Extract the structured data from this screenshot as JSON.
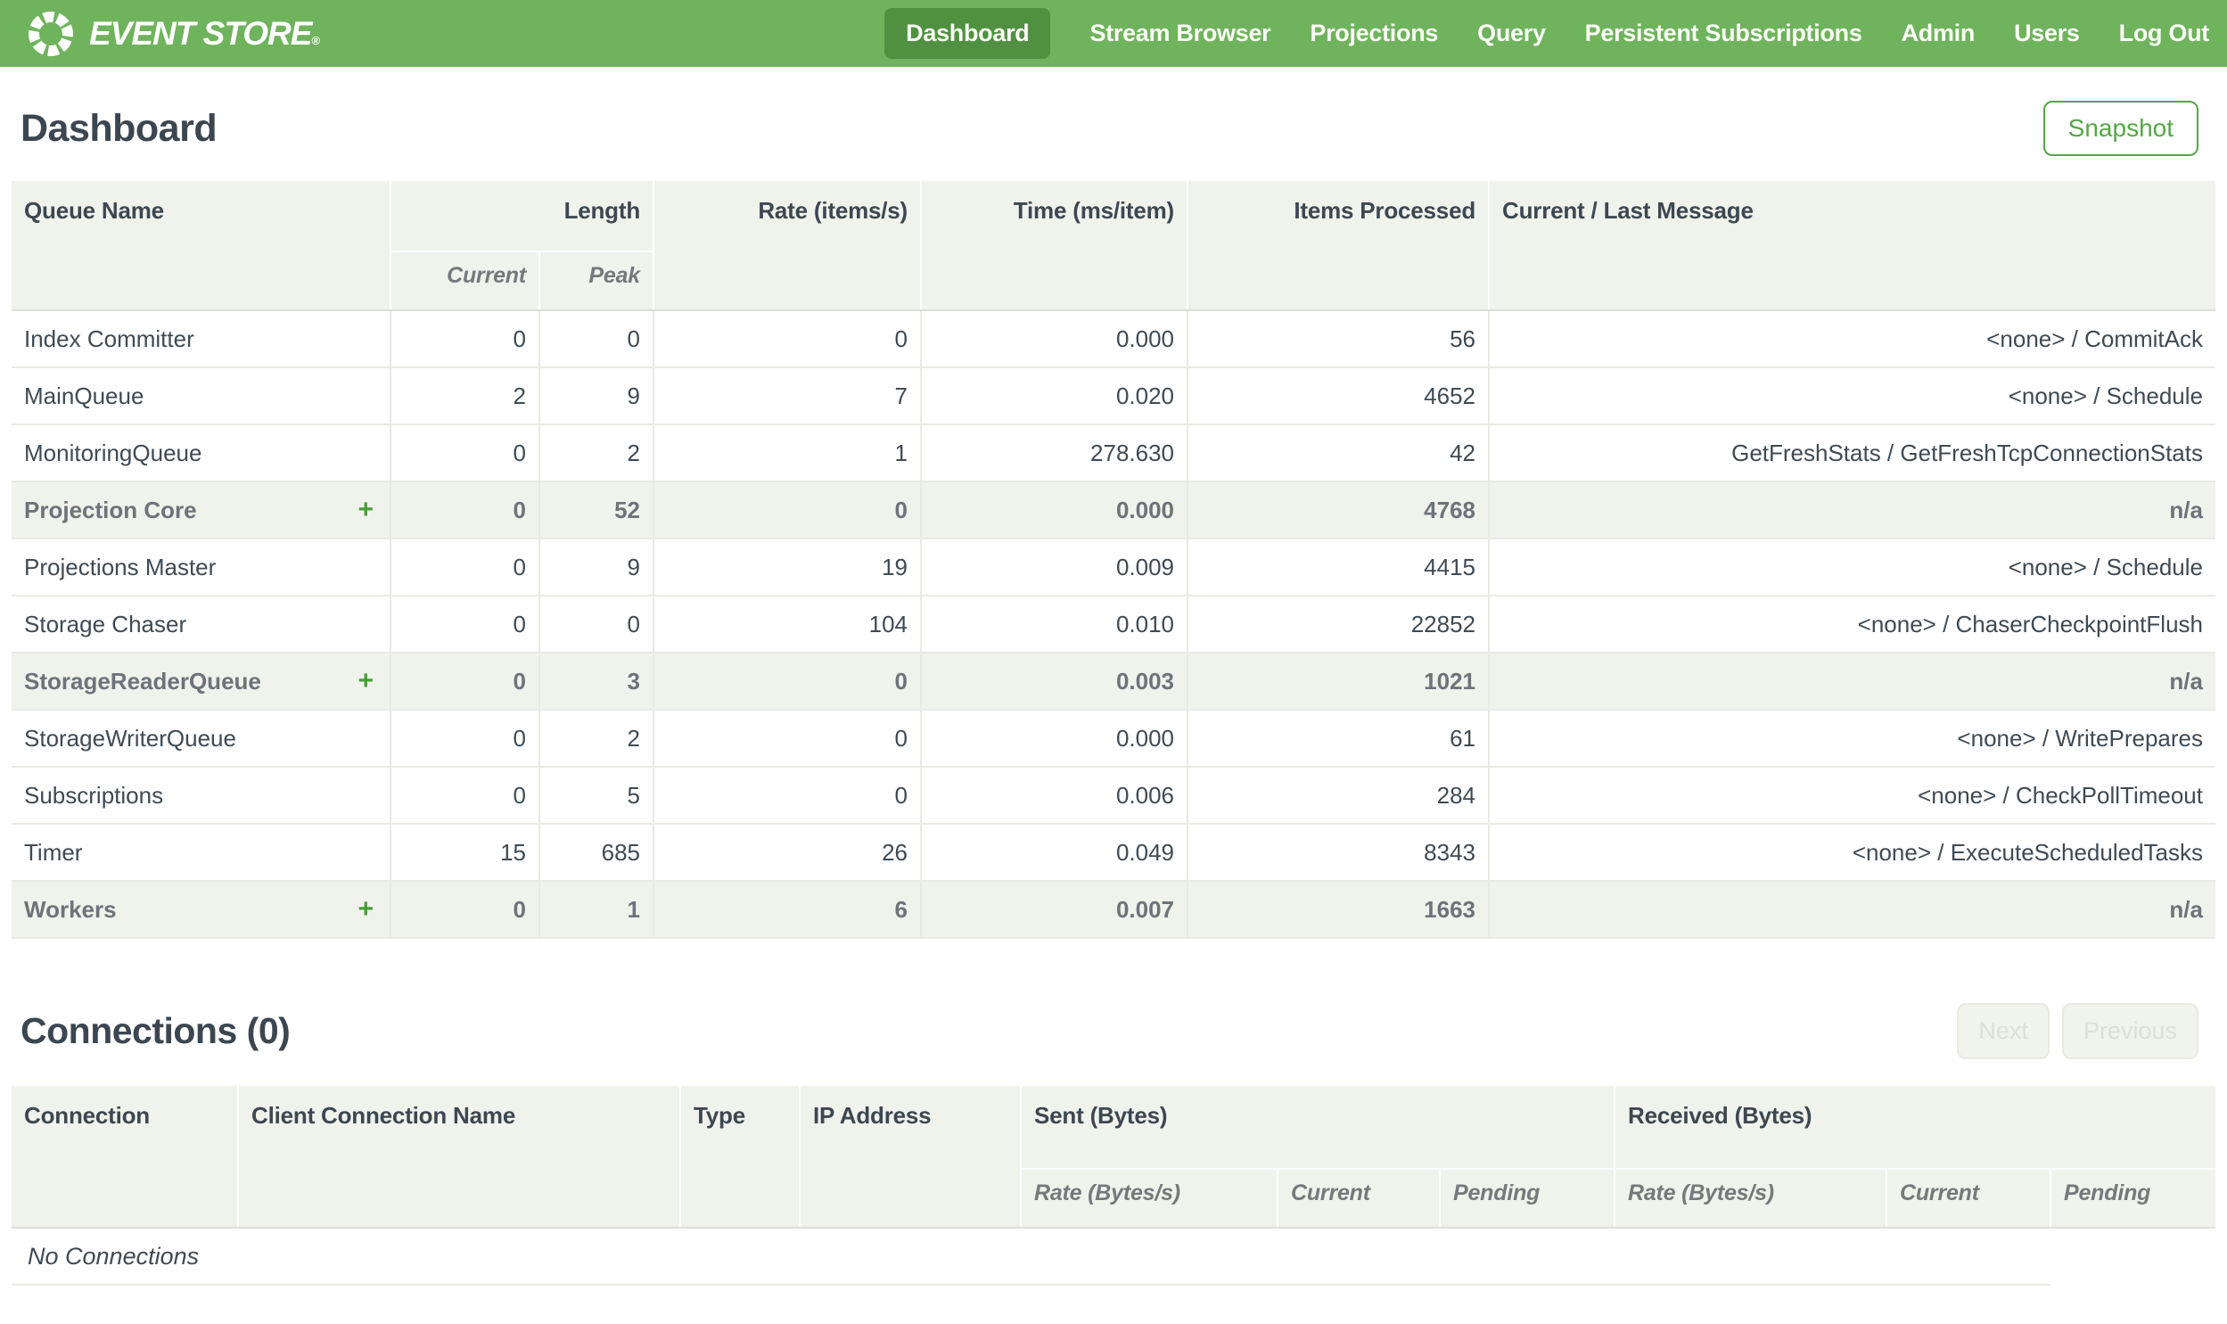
{
  "colors": {
    "brand_green": "#6fb35d",
    "active_nav_green": "#4f9140",
    "accent_green": "#55a647",
    "plus_green": "#469d35",
    "header_bg": "#f0f2ec",
    "text_dark": "#3c4650"
  },
  "nav": {
    "brand": {
      "name": "EVENT STORE",
      "trademark": "®"
    },
    "items": [
      {
        "label": "Dashboard",
        "active": true
      },
      {
        "label": "Stream Browser",
        "active": false
      },
      {
        "label": "Projections",
        "active": false
      },
      {
        "label": "Query",
        "active": false
      },
      {
        "label": "Persistent Subscriptions",
        "active": false
      },
      {
        "label": "Admin",
        "active": false
      },
      {
        "label": "Users",
        "active": false
      },
      {
        "label": "Log Out",
        "active": false
      }
    ]
  },
  "page": {
    "title": "Dashboard",
    "snapshot_button": "Snapshot"
  },
  "queues": {
    "headers": {
      "queue_name": "Queue Name",
      "length": "Length",
      "current": "Current",
      "peak": "Peak",
      "rate": "Rate (items/s)",
      "time": "Time (ms/item)",
      "items_processed": "Items Processed",
      "message": "Current / Last Message"
    },
    "rows": [
      {
        "name": "Index Committer",
        "group": false,
        "current": "0",
        "peak": "0",
        "rate": "0",
        "time": "0.000",
        "items": "56",
        "message": "<none> / CommitAck"
      },
      {
        "name": "MainQueue",
        "group": false,
        "current": "2",
        "peak": "9",
        "rate": "7",
        "time": "0.020",
        "items": "4652",
        "message": "<none> / Schedule"
      },
      {
        "name": "MonitoringQueue",
        "group": false,
        "current": "0",
        "peak": "2",
        "rate": "1",
        "time": "278.630",
        "items": "42",
        "message": "GetFreshStats / GetFreshTcpConnectionStats"
      },
      {
        "name": "Projection Core",
        "group": true,
        "expand": "+",
        "current": "0",
        "peak": "52",
        "rate": "0",
        "time": "0.000",
        "items": "4768",
        "message": "n/a"
      },
      {
        "name": "Projections Master",
        "group": false,
        "current": "0",
        "peak": "9",
        "rate": "19",
        "time": "0.009",
        "items": "4415",
        "message": "<none> / Schedule"
      },
      {
        "name": "Storage Chaser",
        "group": false,
        "current": "0",
        "peak": "0",
        "rate": "104",
        "time": "0.010",
        "items": "22852",
        "message": "<none> / ChaserCheckpointFlush"
      },
      {
        "name": "StorageReaderQueue",
        "group": true,
        "expand": "+",
        "current": "0",
        "peak": "3",
        "rate": "0",
        "time": "0.003",
        "items": "1021",
        "message": "n/a"
      },
      {
        "name": "StorageWriterQueue",
        "group": false,
        "current": "0",
        "peak": "2",
        "rate": "0",
        "time": "0.000",
        "items": "61",
        "message": "<none> / WritePrepares"
      },
      {
        "name": "Subscriptions",
        "group": false,
        "current": "0",
        "peak": "5",
        "rate": "0",
        "time": "0.006",
        "items": "284",
        "message": "<none> / CheckPollTimeout"
      },
      {
        "name": "Timer",
        "group": false,
        "current": "15",
        "peak": "685",
        "rate": "26",
        "time": "0.049",
        "items": "8343",
        "message": "<none> / ExecuteScheduledTasks"
      },
      {
        "name": "Workers",
        "group": true,
        "expand": "+",
        "current": "0",
        "peak": "1",
        "rate": "6",
        "time": "0.007",
        "items": "1663",
        "message": "n/a"
      }
    ]
  },
  "connections": {
    "title": "Connections (0)",
    "next_button": "Next",
    "previous_button": "Previous",
    "headers": {
      "connection": "Connection",
      "client_name": "Client Connection Name",
      "type": "Type",
      "ip": "IP Address",
      "sent": "Sent (Bytes)",
      "received": "Received (Bytes)",
      "rate": "Rate (Bytes/s)",
      "current": "Current",
      "pending": "Pending"
    },
    "empty_message": "No Connections"
  }
}
